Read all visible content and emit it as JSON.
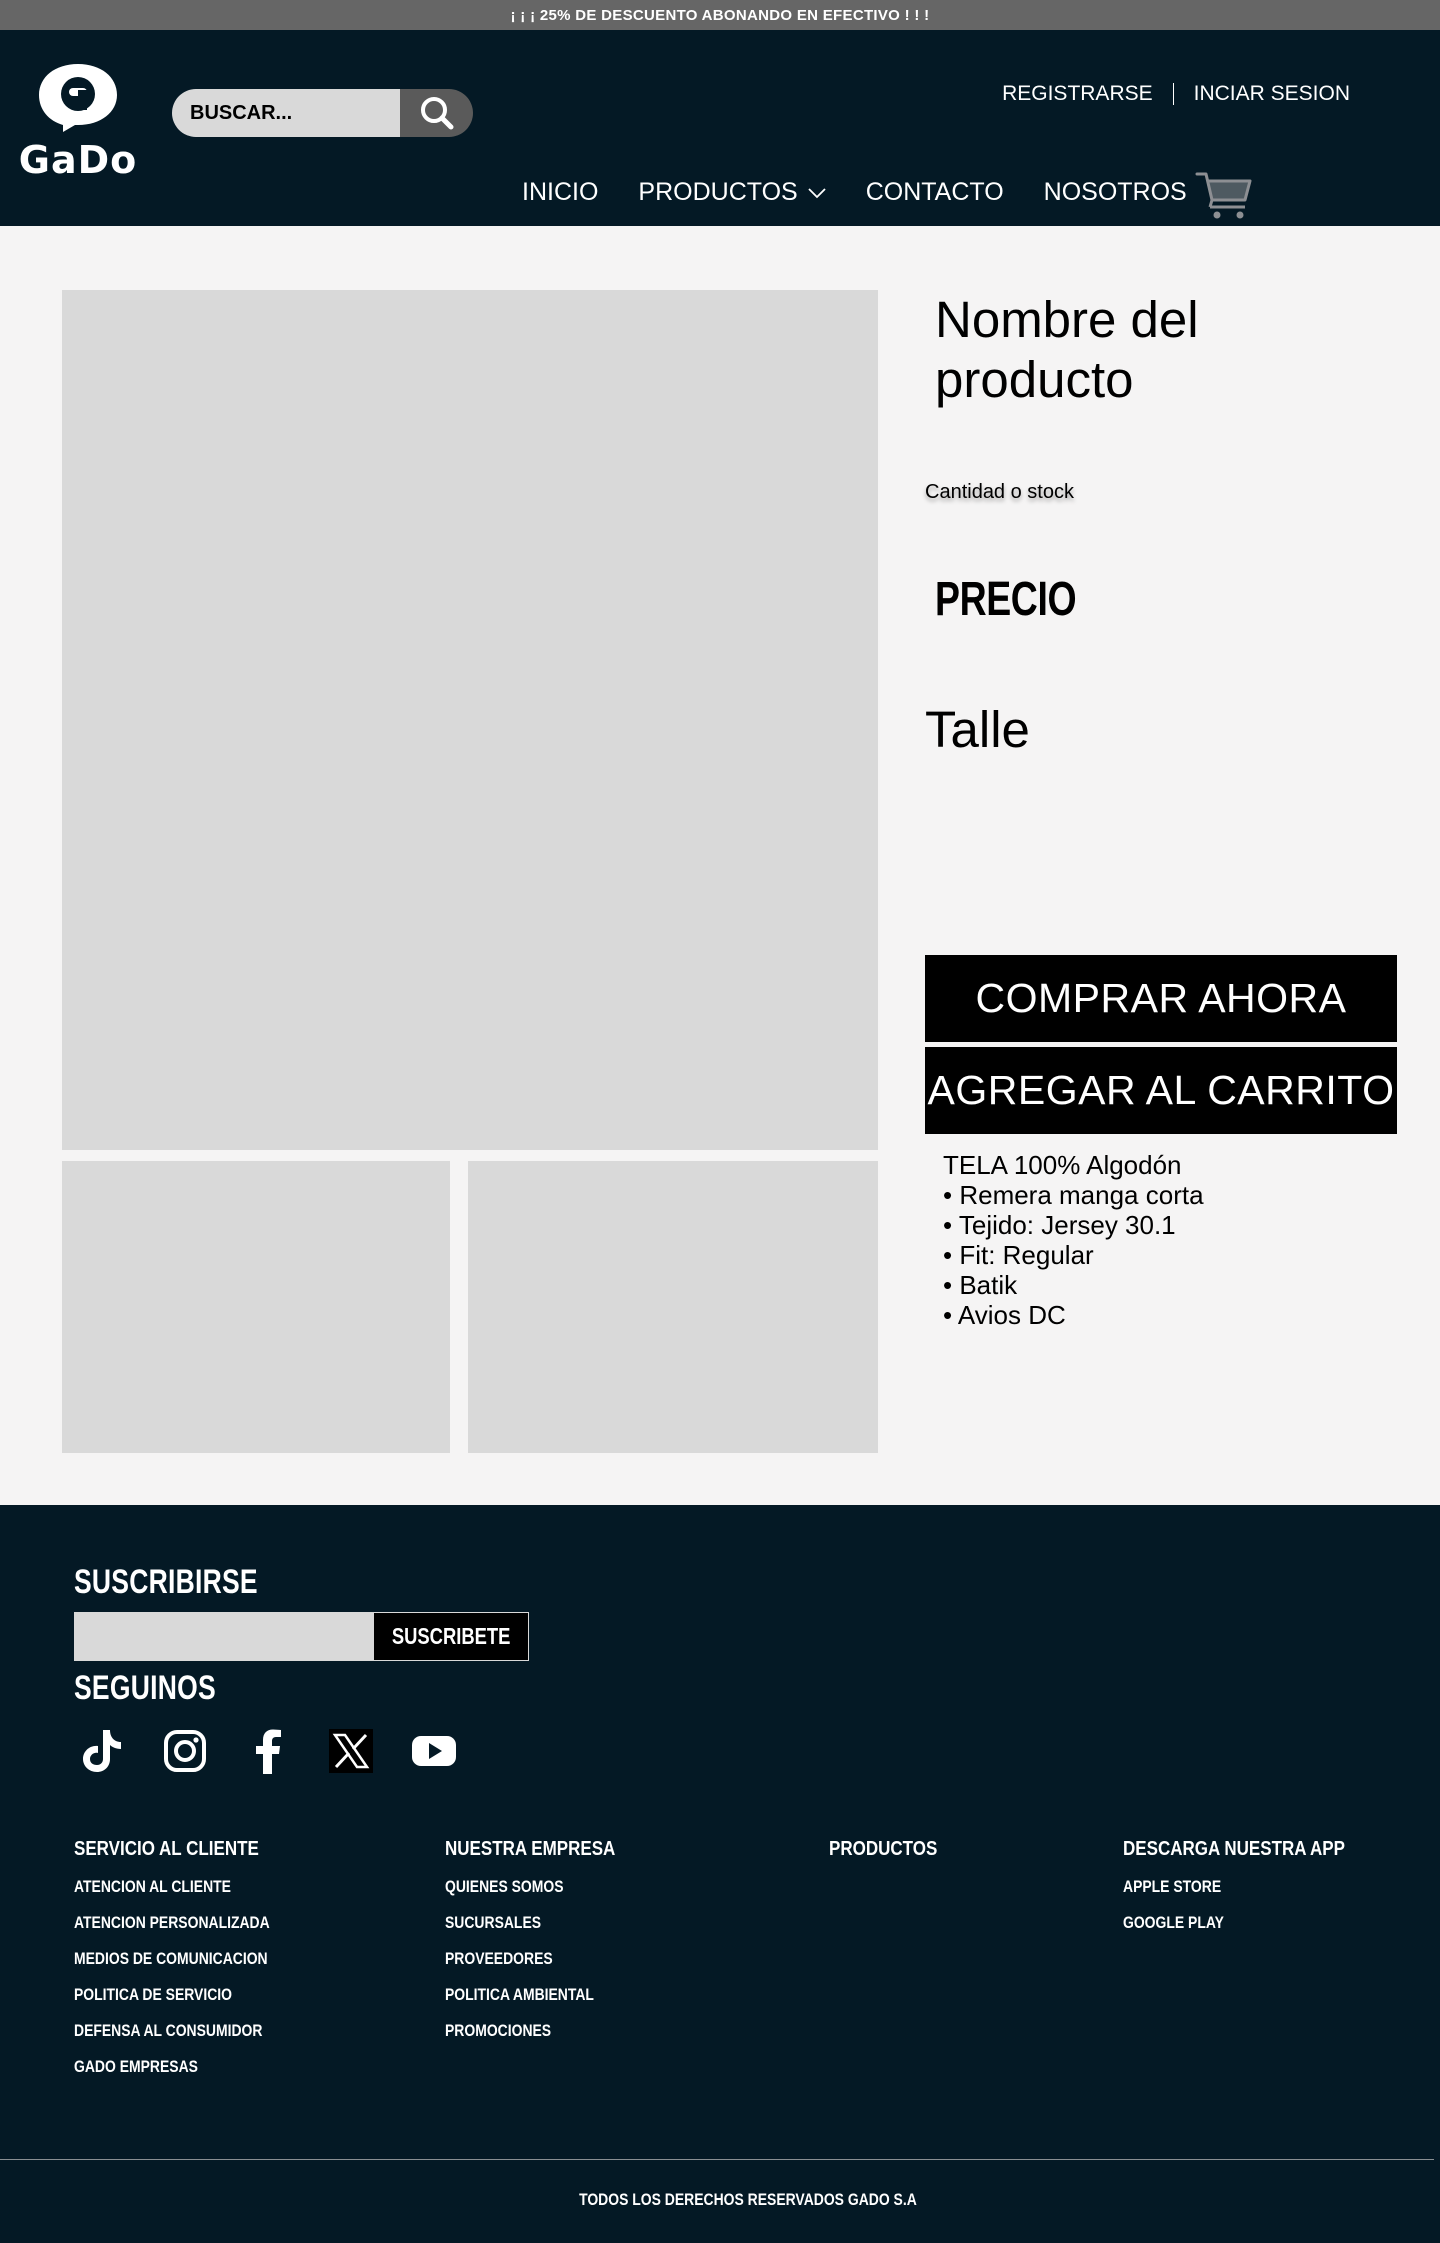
{
  "promo": {
    "text": "¡ ¡ ¡ 25% DE DESCUENTO ABONANDO EN EFECTIVO ! ! !"
  },
  "brand": {
    "name": "GaDo"
  },
  "search": {
    "placeholder": "BUSCAR..."
  },
  "account": {
    "register": "REGISTRARSE",
    "login": "INCIAR SESION"
  },
  "nav": {
    "home": "INICIO",
    "products": "PRODUCTOS",
    "contact": "CONTACTO",
    "about": "NOSOTROS"
  },
  "product": {
    "name": "Nombre del producto",
    "stock": "Cantidad o stock",
    "price": "PRECIO",
    "size_label": "Talle",
    "buy_now": "COMPRAR AHORA",
    "add_to_cart": "AGREGAR AL CARRITO",
    "description": [
      "TELA 100% Algodón",
      "• Remera manga corta",
      "• Tejido: Jersey 30.1",
      "• Fit: Regular",
      "• Batik",
      "• Avios DC"
    ]
  },
  "footer": {
    "subscribe_title": "SUSCRIBIRSE",
    "subscribe_button": "SUSCRIBETE",
    "follow_title": "SEGUINOS",
    "socials": [
      "tiktok-icon",
      "instagram-icon",
      "facebook-icon",
      "x-icon",
      "youtube-icon"
    ],
    "columns": [
      {
        "heading": "SERVICIO AL CLIENTE",
        "links": [
          "ATENCION AL CLIENTE",
          "ATENCION PERSONALIZADA",
          "MEDIOS DE COMUNICACION",
          "POLITICA DE SERVICIO",
          "DEFENSA AL CONSUMIDOR",
          "GADO EMPRESAS"
        ]
      },
      {
        "heading": "NUESTRA EMPRESA",
        "links": [
          "QUIENES SOMOS",
          "SUCURSALES",
          "PROVEEDORES",
          "POLITICA AMBIENTAL",
          "PROMOCIONES"
        ]
      },
      {
        "heading": "PRODUCTOS",
        "links": []
      },
      {
        "heading": "DESCARGA NUESTRA APP",
        "links": [
          "APPLE STORE",
          "GOOGLE PLAY"
        ]
      }
    ],
    "copyright": "TODOS LOS DERECHOS RESERVADOS GADO S.A"
  },
  "colors": {
    "header_bg": "#041925",
    "placeholder_gray": "#d9d9d9",
    "page_bg": "#f5f4f4",
    "promo_bg": "#666666"
  }
}
